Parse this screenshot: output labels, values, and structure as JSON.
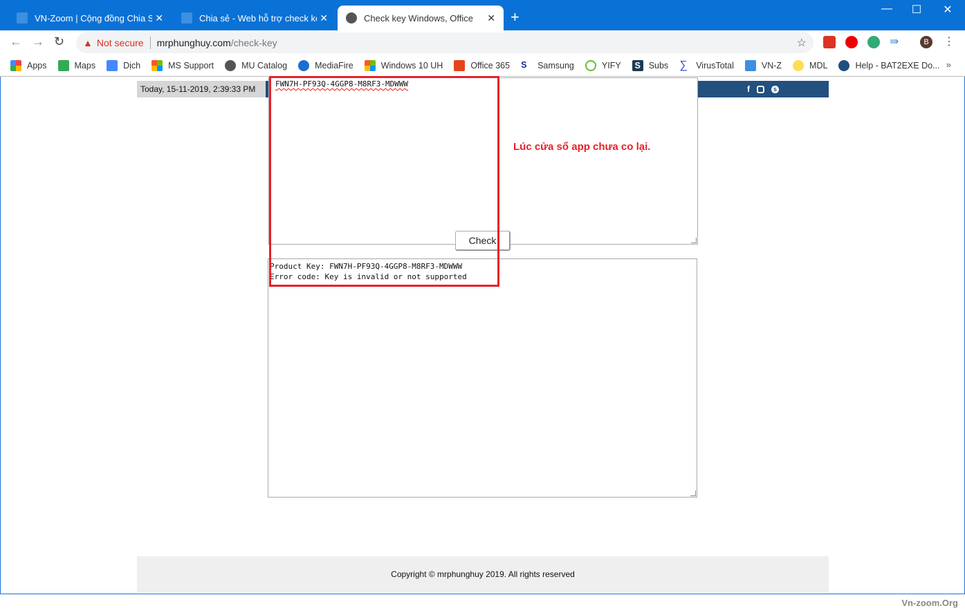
{
  "browser": {
    "tabs": [
      {
        "label": "VN-Zoom | Cộng đồng Chia Sẻ K",
        "active": false
      },
      {
        "label": "Chia sẻ - Web hỗ trợ check key W",
        "active": false
      },
      {
        "label": "Check key Windows, Office",
        "active": true
      }
    ],
    "address": {
      "security": "Not secure",
      "domain": "mrphunghuy.com",
      "path": "/check-key"
    },
    "bookmarks": [
      "Apps",
      "Maps",
      "Dịch",
      "MS Support",
      "MU Catalog",
      "MediaFire",
      "Windows 10 UH",
      "Office 365",
      "Samsung",
      "YIFY",
      "Subs",
      "VirusTotal",
      "VN-Z",
      "MDL",
      "Help - BAT2EXE Do..."
    ],
    "profile_initial": "B",
    "accent": "#0a72d6"
  },
  "page": {
    "datetime": "Today, 15-11-2019, 2:39:33 PM",
    "social": [
      "facebook",
      "instagram",
      "skype"
    ],
    "key_input": "FWN7H-PF93Q-4GGP8-M8RF3-MDWWW",
    "check_label": "Check",
    "result": "Product Key: FWN7H-PF93Q-4GGP8-M8RF3-MDWWW\nError code: Key is invalid or not supported",
    "annotation": "Lúc cửa sổ app chưa co lại.",
    "footer": "Copyright © mrphunghuy 2019. All rights reserved"
  },
  "watermark": "Vn-zoom.Org"
}
